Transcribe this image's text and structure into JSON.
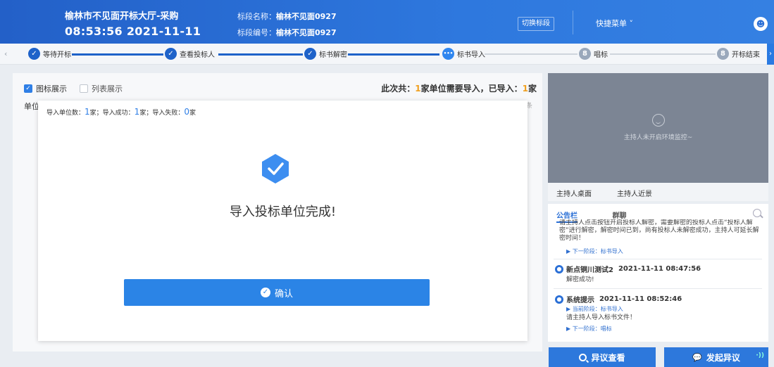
{
  "header": {
    "title": "榆林市不见面开标大厅-采购",
    "datetime": "08:53:56 2021-11-11",
    "section_name_label": "标段名称：",
    "section_name_value": "榆林不见面0927",
    "section_code_label": "标段编号：",
    "section_code_value": "榆林不见面0927",
    "switch_button": "切换标段",
    "quick_menu": "快捷菜单 ˅"
  },
  "steps": [
    {
      "label": "等待开标",
      "state": "done",
      "icon": "✓"
    },
    {
      "label": "查看投标人",
      "state": "done",
      "icon": "✓"
    },
    {
      "label": "标书解密",
      "state": "done",
      "icon": "✓"
    },
    {
      "label": "标书导入",
      "state": "current",
      "icon": "•••"
    },
    {
      "label": "唱标",
      "state": "todo",
      "icon": "8"
    },
    {
      "label": "开标结束",
      "state": "todo",
      "icon": "8"
    }
  ],
  "main": {
    "tab_icon_view": "图标展示",
    "tab_list_view": "列表展示",
    "summary_prefix": "此次共：",
    "summary_need": "1",
    "summary_mid": "家单位需要导入，已导入：",
    "summary_done": "1",
    "summary_suffix": "家",
    "unit_label": "单位",
    "total_hint": "共1条"
  },
  "dialog": {
    "stat_prefix1": "导入单位数：",
    "stat_count": "1",
    "stat_unit1": "家；导入成功：",
    "stat_success": "1",
    "stat_unit2": "家；导入失败：",
    "stat_fail": "0",
    "stat_unit3": "家",
    "message": "导入投标单位完成!",
    "confirm_button": "确认"
  },
  "video": {
    "status_text": "主持人未开启环境监控~",
    "tab_desktop": "主持人桌面",
    "tab_closeup": "主持人近景"
  },
  "notice": {
    "tab_board": "公告栏",
    "tab_chat": "群聊",
    "first_text": "请主持人点击按钮开启投标人解密，需要解密的投标人点击“投标人解密”进行解密，解密时间已到，尚有投标人未解密成功，主持人可延长解密时间！",
    "first_next_stage": "▶ 下一阶段：标书导入",
    "msg1_sender": "新点铜川测试2",
    "msg1_time": "2021-11-11 08:47:56",
    "msg1_text": "解密成功!",
    "msg2_sender": "系统提示",
    "msg2_time": "2021-11-11 08:52:46",
    "msg2_current_stage": "▶ 当前阶段：标书导入",
    "msg2_text": "请主持人导入标书文件！",
    "msg2_next_stage": "▶ 下一阶段：唱标"
  },
  "bottom": {
    "query_button": "异议查看",
    "raise_button": "发起异议"
  },
  "colors": {
    "header_blue": "#2a6fd6",
    "accent_orange": "#f0a020",
    "button_blue": "#2b84e6"
  }
}
